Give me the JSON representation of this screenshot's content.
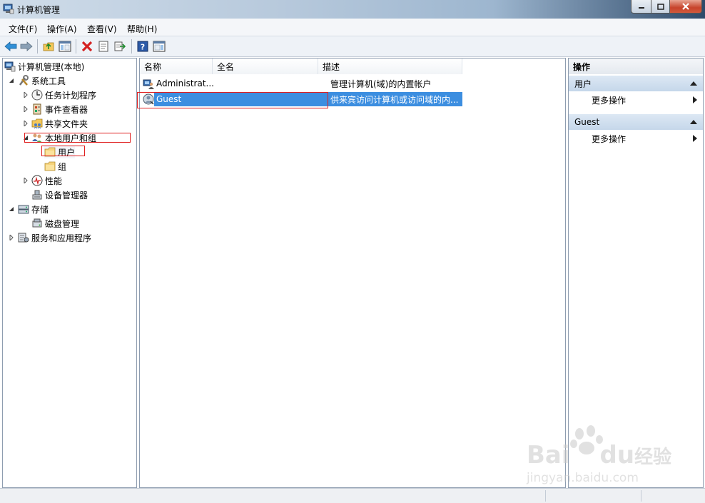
{
  "window": {
    "title": "计算机管理"
  },
  "menu": [
    "文件(F)",
    "操作(A)",
    "查看(V)",
    "帮助(H)"
  ],
  "tree": {
    "root": "计算机管理(本地)",
    "system_tools": "系统工具",
    "task_scheduler": "任务计划程序",
    "event_viewer": "事件查看器",
    "shared_folders": "共享文件夹",
    "local_users": "本地用户和组",
    "users": "用户",
    "groups": "组",
    "performance": "性能",
    "device_manager": "设备管理器",
    "storage": "存储",
    "disk_mgmt": "磁盘管理",
    "services": "服务和应用程序"
  },
  "list": {
    "columns": [
      "名称",
      "全名",
      "描述"
    ],
    "rows": [
      {
        "name": "Administrat...",
        "fullname": "",
        "desc": "管理计算机(域)的内置帐户"
      },
      {
        "name": "Guest",
        "fullname": "",
        "desc": "供来宾访问计算机或访问域的内..."
      }
    ]
  },
  "actions": {
    "header": "操作",
    "group1": "用户",
    "group1_more": "更多操作",
    "group2": "Guest",
    "group2_more": "更多操作"
  },
  "watermark": {
    "brand": "Bai",
    "brand2": "du",
    "brand3": "经验",
    "url": "jingyan.baidu.com"
  }
}
